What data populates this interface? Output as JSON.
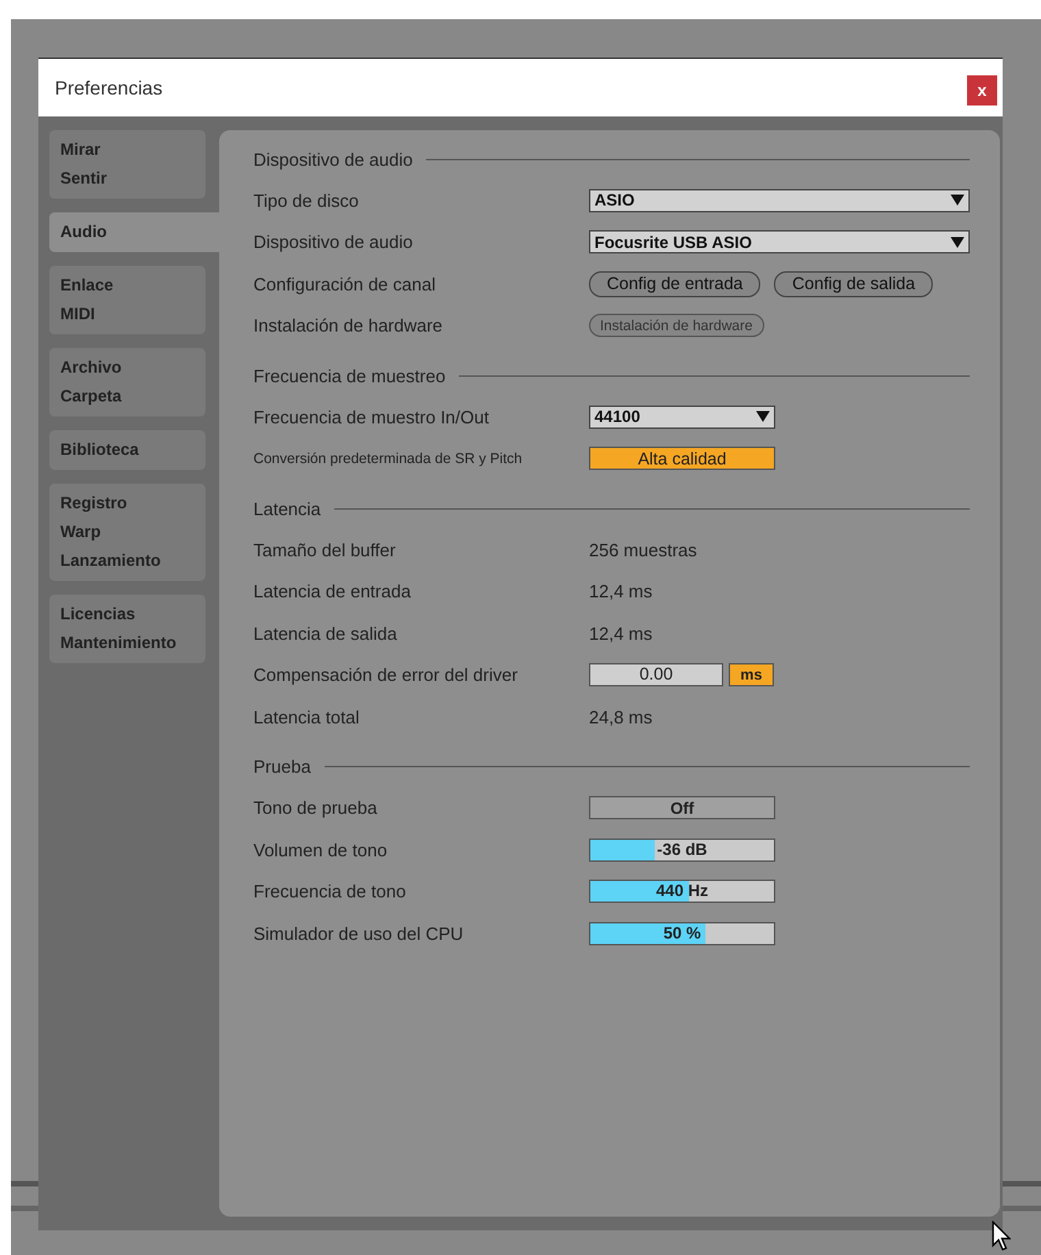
{
  "window": {
    "title": "Preferencias",
    "close": "x"
  },
  "sidebar": {
    "items": [
      {
        "lines": [
          "Mirar",
          "Sentir"
        ],
        "selected": false
      },
      {
        "lines": [
          "Audio"
        ],
        "selected": true
      },
      {
        "lines": [
          "Enlace",
          "MIDI"
        ],
        "selected": false
      },
      {
        "lines": [
          "Archivo",
          "Carpeta"
        ],
        "selected": false
      },
      {
        "lines": [
          "Biblioteca"
        ],
        "selected": false
      },
      {
        "lines": [
          "Registro",
          "Warp",
          "Lanzamiento"
        ],
        "selected": false
      },
      {
        "lines": [
          "Licencias",
          "Mantenimiento"
        ],
        "selected": false
      }
    ]
  },
  "sections": [
    {
      "title": "Dispositivo de audio",
      "rows": [
        {
          "kind": "dropdown",
          "label": "Tipo de disco",
          "value": "ASIO"
        },
        {
          "kind": "dropdown",
          "label": "Dispositivo de audio",
          "value": "Focusrite USB ASIO"
        },
        {
          "kind": "buttons",
          "label": "Configuración de canal",
          "buttons": [
            {
              "label": "Config de entrada",
              "disabled": false
            },
            {
              "label": "Config de salida",
              "disabled": false
            }
          ]
        },
        {
          "kind": "buttons",
          "label": "Instalación de hardware",
          "buttons": [
            {
              "label": "Instalación de hardware",
              "disabled": true
            }
          ]
        }
      ]
    },
    {
      "title": "Frecuencia de muestreo",
      "rows": [
        {
          "kind": "dropdown",
          "label": "Frecuencia de muestro In/Out",
          "value": "44100"
        },
        {
          "kind": "chooser",
          "label": "Conversión predeterminada de SR y Pitch",
          "value": "Alta calidad"
        }
      ]
    },
    {
      "title": "Latencia",
      "rows": [
        {
          "kind": "value",
          "label": "Tamaño del buffer",
          "value": "256 muestras"
        },
        {
          "kind": "value",
          "label": "Latencia de entrada",
          "value": "12,4 ms"
        },
        {
          "kind": "value",
          "label": "Latencia de salida",
          "value": "12,4 ms"
        },
        {
          "kind": "number",
          "label": "Compensación de error del driver",
          "value": "0.00",
          "unit": "ms"
        },
        {
          "kind": "value",
          "label": "Latencia total",
          "value": "24,8 ms"
        }
      ]
    },
    {
      "title": "Prueba",
      "rows": [
        {
          "kind": "toggle",
          "label": "Tono de prueba",
          "value": "Off",
          "on": false
        },
        {
          "kind": "slider",
          "label": "Volumen de tono",
          "value": "-36 dB",
          "level": 0.35
        },
        {
          "kind": "slider",
          "label": "Frecuencia de tono",
          "value": "440 Hz",
          "level": 0.54
        },
        {
          "kind": "slider",
          "label": "Simulador de uso del CPU",
          "value": "50 %",
          "level": 0.63
        }
      ]
    }
  ]
}
